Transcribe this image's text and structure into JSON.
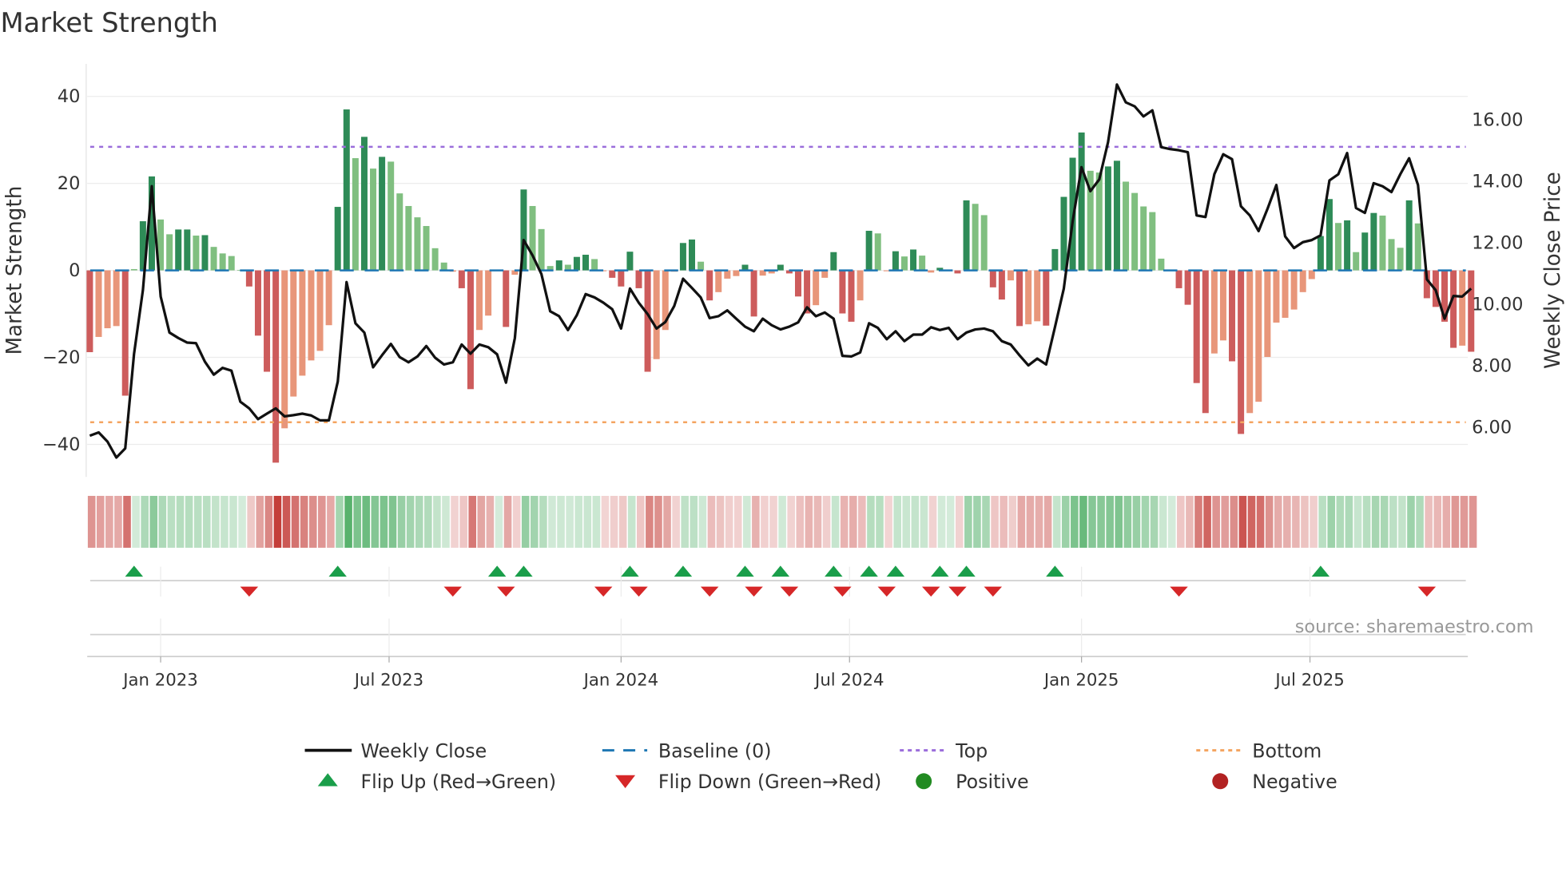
{
  "title": "Market Strength",
  "source": "source: sharemaestro.com",
  "chart_data": {
    "type": "bar",
    "title": "Market Strength",
    "ylabel": "Market Strength",
    "y2label": "Weekly Close Price",
    "ylim": [
      -48,
      48
    ],
    "y2lim": [
      4.6,
      17.5
    ],
    "yticks": [
      40,
      20,
      0,
      -20,
      -40
    ],
    "yticklabels": [
      "40",
      "20",
      "0",
      "−20",
      "−40"
    ],
    "y2ticks": [
      16,
      14,
      12,
      10,
      8,
      6
    ],
    "y2ticklabels": [
      "16.00",
      "14.00",
      "12.00",
      "10.00",
      "8.00",
      "6.00"
    ],
    "xticks": [
      {
        "label": "Jan 2023",
        "week": 9
      },
      {
        "label": "Jul 2023",
        "week": 34.8
      },
      {
        "label": "Jan 2024",
        "week": 61
      },
      {
        "label": "Jul 2024",
        "week": 86.8
      },
      {
        "label": "Jan 2025",
        "week": 113
      },
      {
        "label": "Jul 2025",
        "week": 138.8
      }
    ],
    "grid": true,
    "top_level": 28.4,
    "bottom_level": -34.9,
    "baseline": 0,
    "strength": [
      -18.8,
      -15.3,
      -13.3,
      -12.8,
      -28.8,
      0.3,
      11.3,
      21.6,
      11.7,
      8.3,
      9.4,
      9.4,
      8.0,
      8.1,
      5.4,
      3.9,
      3.3,
      0.1,
      -3.7,
      -15.0,
      -23.3,
      -44.2,
      -36.3,
      -29.0,
      -24.2,
      -20.7,
      -18.5,
      -12.6,
      14.6,
      37.0,
      25.8,
      30.7,
      23.4,
      26.1,
      25.0,
      17.7,
      14.8,
      12.2,
      10.2,
      5.1,
      1.8,
      -0.3,
      -4.1,
      -27.3,
      -13.7,
      -10.4,
      0.1,
      -13.0,
      -1.0,
      18.6,
      14.8,
      9.5,
      1.0,
      2.3,
      1.3,
      3.1,
      3.6,
      2.6,
      -0.2,
      -1.7,
      -3.7,
      4.3,
      -4.1,
      -23.3,
      -20.4,
      -13.7,
      -0.3,
      6.3,
      7.1,
      2.0,
      -6.9,
      -5.0,
      -1.9,
      -1.3,
      1.3,
      -10.6,
      -1.2,
      -0.7,
      1.3,
      -0.7,
      -6.0,
      -9.9,
      -8.0,
      -1.7,
      4.2,
      -9.9,
      -11.8,
      -6.9,
      9.1,
      8.5,
      -0.2,
      4.4,
      3.2,
      4.8,
      3.4,
      -0.5,
      0.6,
      0.2,
      -0.7,
      16.1,
      15.3,
      12.7,
      -3.9,
      -6.7,
      -2.3,
      -12.8,
      -12.4,
      -11.7,
      -12.7,
      4.9,
      16.9,
      25.9,
      31.7,
      22.9,
      22.5,
      23.9,
      25.2,
      20.4,
      17.8,
      14.7,
      13.4,
      2.7,
      0.1,
      -4.1,
      -7.9,
      -25.9,
      -32.8,
      -19.1,
      -16.1,
      -20.9,
      -37.6,
      -32.8,
      -30.2,
      -19.9,
      -12.0,
      -10.9,
      -9.0,
      -5.0,
      -2.0,
      7.9,
      16.4,
      10.9,
      11.5,
      4.2,
      8.7,
      13.2,
      12.6,
      7.2,
      5.2,
      16.1,
      10.8,
      -6.4,
      -8.4,
      -11.8,
      -17.8,
      -17.3,
      -18.7
    ],
    "strengthening": [
      1,
      0,
      0,
      0,
      1,
      0,
      1,
      1,
      0,
      0,
      1,
      1,
      0,
      1,
      0,
      0,
      0,
      0,
      1,
      1,
      1,
      1,
      0,
      0,
      0,
      0,
      0,
      0,
      1,
      1,
      0,
      1,
      0,
      1,
      0,
      0,
      0,
      0,
      0,
      0,
      0,
      0,
      1,
      1,
      0,
      0,
      0,
      1,
      0,
      1,
      0,
      0,
      0,
      1,
      0,
      1,
      1,
      0,
      0,
      1,
      1,
      1,
      1,
      1,
      0,
      0,
      0,
      1,
      1,
      0,
      1,
      0,
      0,
      0,
      1,
      1,
      0,
      0,
      1,
      1,
      1,
      1,
      0,
      0,
      1,
      1,
      1,
      0,
      1,
      0,
      0,
      1,
      0,
      1,
      0,
      0,
      1,
      0,
      1,
      1,
      0,
      0,
      1,
      1,
      0,
      1,
      0,
      0,
      1,
      1,
      1,
      1,
      1,
      0,
      0,
      1,
      1,
      0,
      0,
      0,
      0,
      0,
      0,
      1,
      1,
      1,
      1,
      0,
      0,
      1,
      1,
      0,
      0,
      0,
      0,
      0,
      0,
      0,
      0,
      1,
      1,
      0,
      1,
      0,
      1,
      1,
      0,
      0,
      0,
      1,
      0,
      1,
      1,
      1,
      1,
      0,
      1
    ],
    "weekly_close": [
      5.69,
      5.8,
      5.5,
      4.98,
      5.28,
      8.35,
      10.43,
      13.81,
      10.22,
      9.05,
      8.87,
      8.72,
      8.7,
      8.1,
      7.68,
      7.9,
      7.81,
      6.8,
      6.58,
      6.23,
      6.41,
      6.58,
      6.32,
      6.36,
      6.41,
      6.35,
      6.19,
      6.19,
      7.45,
      10.69,
      9.35,
      9.05,
      7.92,
      8.31,
      8.68,
      8.25,
      8.08,
      8.27,
      8.61,
      8.23,
      8.01,
      8.08,
      8.66,
      8.36,
      8.66,
      8.57,
      8.34,
      7.42,
      8.87,
      12.06,
      11.56,
      10.95,
      9.74,
      9.58,
      9.13,
      9.61,
      10.3,
      10.19,
      10.02,
      9.81,
      9.18,
      10.48,
      10.02,
      9.65,
      9.18,
      9.39,
      9.91,
      10.8,
      10.5,
      10.19,
      9.52,
      9.58,
      9.77,
      9.5,
      9.24,
      9.09,
      9.5,
      9.29,
      9.15,
      9.24,
      9.38,
      9.87,
      9.58,
      9.7,
      9.5,
      8.29,
      8.27,
      8.4,
      9.35,
      9.2,
      8.83,
      9.09,
      8.77,
      8.98,
      8.98,
      9.22,
      9.13,
      9.2,
      8.83,
      9.05,
      9.15,
      9.18,
      9.09,
      8.77,
      8.66,
      8.31,
      7.98,
      8.2,
      8.01,
      9.22,
      10.48,
      12.68,
      14.43,
      13.65,
      14.03,
      15.24,
      17.12,
      16.54,
      16.41,
      16.08,
      16.28,
      15.08,
      15.02,
      14.98,
      14.92,
      12.86,
      12.81,
      14.2,
      14.85,
      14.69,
      13.16,
      12.86,
      12.35,
      13.07,
      13.85,
      12.18,
      11.8,
      11.99,
      12.06,
      12.21,
      14.0,
      14.2,
      14.89,
      13.1,
      12.94,
      13.91,
      13.81,
      13.62,
      14.2,
      14.72,
      13.85,
      10.78,
      10.43,
      9.5,
      10.24,
      10.22,
      10.48
    ],
    "flip_up_weeks": [
      6,
      29,
      47,
      50,
      62,
      68,
      75,
      79,
      85,
      89,
      92,
      97,
      100,
      110,
      140
    ],
    "flip_down_weeks": [
      19,
      42,
      48,
      59,
      63,
      71,
      76,
      80,
      86,
      91,
      96,
      99,
      103,
      124,
      152
    ],
    "legend_position": "bottom",
    "legend": [
      {
        "label": "Weekly Close",
        "kind": "line"
      },
      {
        "label": "Baseline (0)",
        "kind": "dash"
      },
      {
        "label": "Top",
        "kind": "dot-top"
      },
      {
        "label": "Bottom",
        "kind": "dot-bottom"
      },
      {
        "label": "Flip Up (Red→Green)",
        "kind": "up"
      },
      {
        "label": "Flip Down (Green→Red)",
        "kind": "down"
      },
      {
        "label": "Positive",
        "kind": "pos"
      },
      {
        "label": "Negative",
        "kind": "neg"
      }
    ]
  },
  "colors": {
    "strong_green": "#2e8b57",
    "weak_green": "#80bf80",
    "strong_red": "#cd5c5c",
    "weak_red": "#e8967a",
    "baseline": "#1f77b4",
    "top": "#9b6ddb",
    "bottom": "#f4a460",
    "flip_up": "#1a9e4a",
    "flip_down": "#d62728",
    "positive": "#228b22",
    "negative": "#b22222",
    "line": "#111111"
  }
}
